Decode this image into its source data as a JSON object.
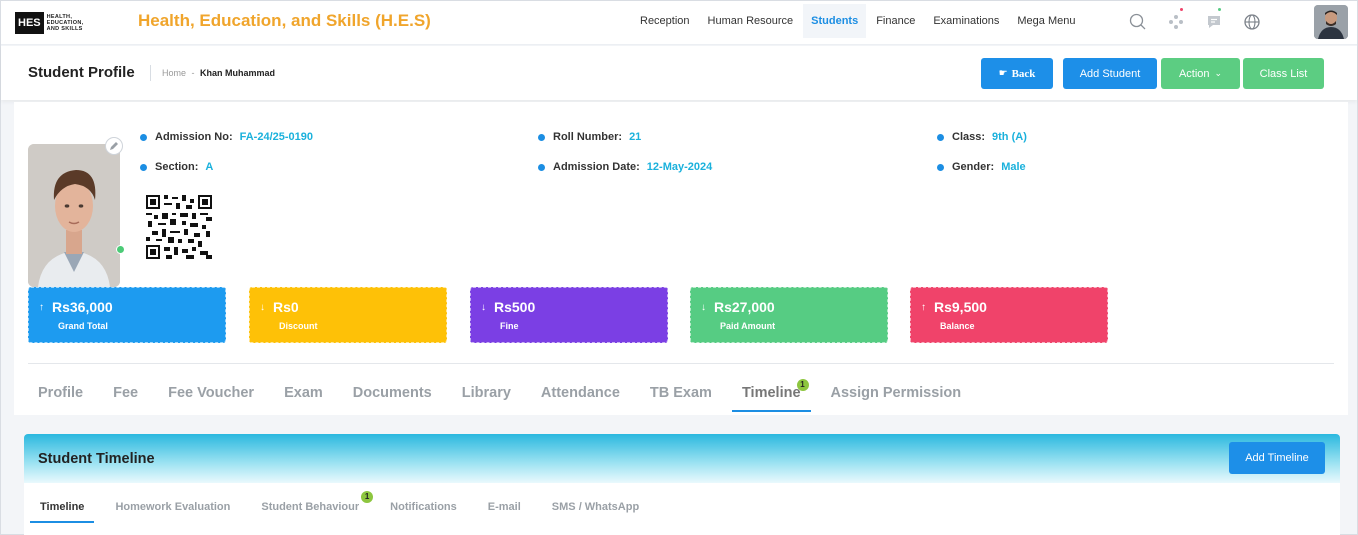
{
  "app": {
    "logo_mark": "HES",
    "logo_text": [
      "HEALTH,",
      "EDUCATION,",
      "AND SKILLS"
    ],
    "title": "Health, Education, and Skills (H.E.S)"
  },
  "nav": {
    "items": [
      {
        "label": "Reception"
      },
      {
        "label": "Human Resource"
      },
      {
        "label": "Students",
        "active": true
      },
      {
        "label": "Finance"
      },
      {
        "label": "Examinations"
      },
      {
        "label": "Mega Menu"
      }
    ],
    "icons": [
      "search-icon",
      "apps-icon",
      "chat-icon",
      "globe-icon"
    ]
  },
  "subheader": {
    "title": "Student Profile",
    "breadcrumb_home": "Home",
    "breadcrumb_sep": "-",
    "breadcrumb_current": "Khan Muhammad",
    "back_label": "Back",
    "add_student_label": "Add Student",
    "action_label": "Action",
    "class_list_label": "Class List"
  },
  "profile": {
    "fields": [
      {
        "label": "Admission No:",
        "value": "FA-24/25-0190"
      },
      {
        "label": "Roll Number:",
        "value": "21"
      },
      {
        "label": "Class:",
        "value": "9th (A)"
      },
      {
        "label": "Section:",
        "value": "A"
      },
      {
        "label": "Admission Date:",
        "value": "12-May-2024"
      },
      {
        "label": "Gender:",
        "value": "Male"
      }
    ]
  },
  "stats": [
    {
      "amount": "Rs36,000",
      "label": "Grand Total",
      "arrow": "up",
      "color": "#1d9bf0"
    },
    {
      "amount": "Rs0",
      "label": "Discount",
      "arrow": "down",
      "color": "#fec107"
    },
    {
      "amount": "Rs500",
      "label": "Fine",
      "arrow": "down",
      "color": "#7b3fe4"
    },
    {
      "amount": "Rs27,000",
      "label": "Paid Amount",
      "arrow": "down",
      "color": "#56cc83"
    },
    {
      "amount": "Rs9,500",
      "label": "Balance",
      "arrow": "up",
      "color": "#f0436a"
    }
  ],
  "tabs": [
    {
      "label": "Profile"
    },
    {
      "label": "Fee"
    },
    {
      "label": "Fee Voucher"
    },
    {
      "label": "Exam"
    },
    {
      "label": "Documents"
    },
    {
      "label": "Library"
    },
    {
      "label": "Attendance"
    },
    {
      "label": "TB Exam"
    },
    {
      "label": "Timeline",
      "active": true,
      "badge": "1"
    },
    {
      "label": "Assign Permission"
    }
  ],
  "timeline": {
    "title": "Student Timeline",
    "add_label": "Add Timeline",
    "subtabs": [
      {
        "label": "Timeline",
        "active": true
      },
      {
        "label": "Homework Evaluation"
      },
      {
        "label": "Student Behaviour",
        "badge": "1"
      },
      {
        "label": "Notifications"
      },
      {
        "label": "E-mail"
      },
      {
        "label": "SMS / WhatsApp"
      }
    ]
  }
}
